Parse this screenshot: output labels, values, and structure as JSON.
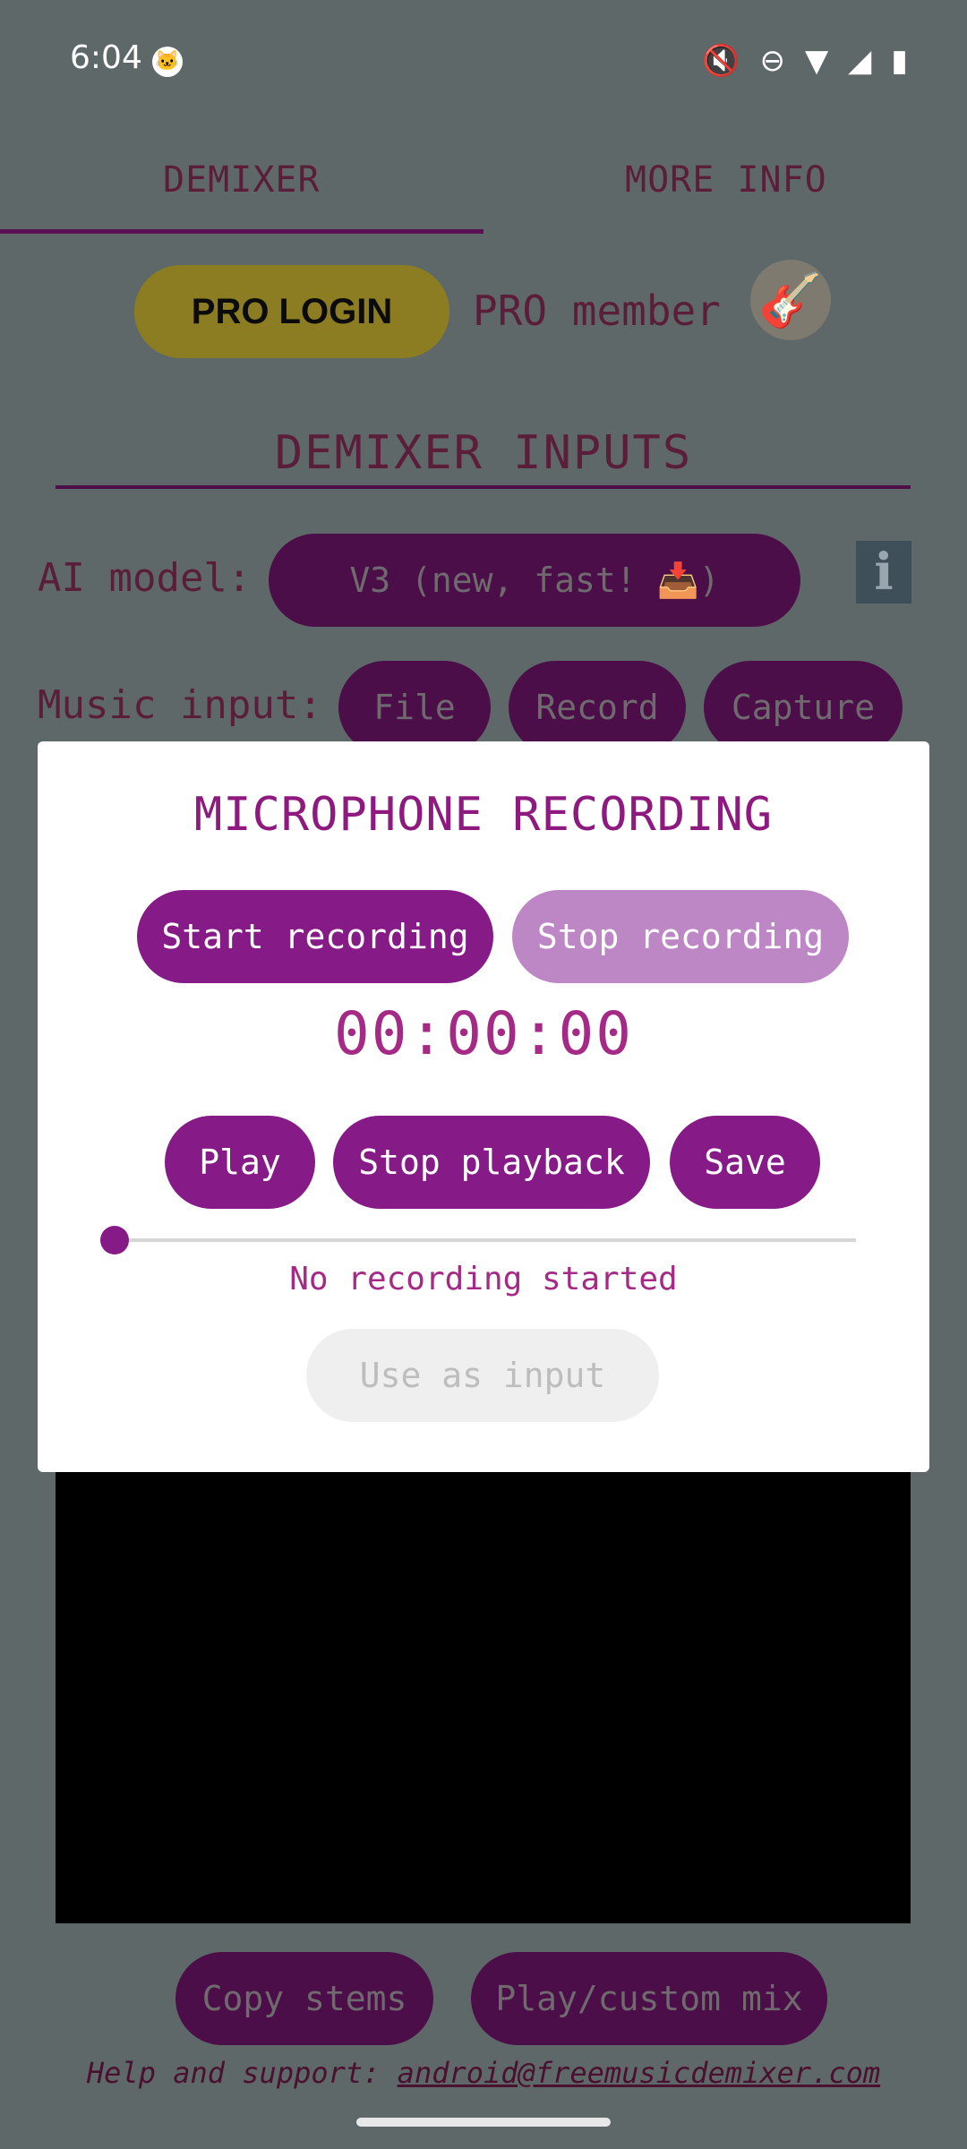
{
  "status_bar": {
    "time": "6:04",
    "icons": [
      "cat-icon",
      "mute-icon",
      "dnd-icon",
      "wifi-icon",
      "signal-icon",
      "battery-icon"
    ]
  },
  "tabs": [
    {
      "label": "DEMIXER",
      "selected": true
    },
    {
      "label": "MORE INFO",
      "selected": false
    }
  ],
  "pro": {
    "login_label": "PRO LOGIN",
    "member_text": "PRO member"
  },
  "inputs_section": {
    "title": "DEMIXER INPUTS",
    "ai_model_label": "AI model:",
    "ai_model_value": "V3 (new, fast! 📥)",
    "music_input_label": "Music input:",
    "music_input_buttons": [
      "File",
      "Record",
      "Capture"
    ]
  },
  "dialog": {
    "title": "MICROPHONE RECORDING",
    "start_label": "Start recording",
    "stop_label": "Stop recording",
    "timer": "00:00:00",
    "play_label": "Play",
    "stop_playback_label": "Stop playback",
    "save_label": "Save",
    "status_text": "No recording started",
    "use_as_input_label": "Use as input",
    "progress": 0
  },
  "bottom": {
    "copy_stems_label": "Copy stems",
    "play_mix_label": "Play/custom mix",
    "help_prefix": "Help and support: ",
    "help_email": "android@freemusicdemixer.com"
  },
  "colors": {
    "accent": "#861a87",
    "accent_light": "#bd86c5",
    "scrim": "#5f6868",
    "pro_gold": "#8d7d22"
  }
}
